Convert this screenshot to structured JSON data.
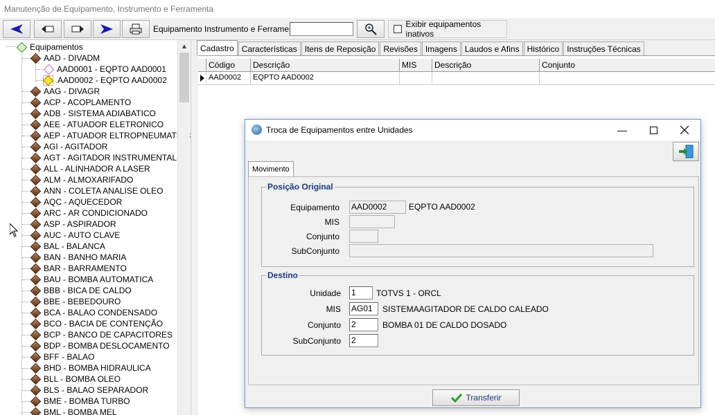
{
  "window": {
    "title": "Manutenção de Equipamento, Instrumento e Ferramenta"
  },
  "toolbar": {
    "search_label": "Equipamento Instrumento e Ferramenta",
    "search_value": "",
    "show_inactive_label": "Exibir equipamentos inativos"
  },
  "tree": {
    "root": "Equipamentos",
    "expanded": "AAD - DIVADM",
    "children": [
      "AAD0001 - EQPTO AAD0001",
      "AAD0002 - EQPTO AAD0002"
    ],
    "items": [
      "AAG - DIVAGR",
      "ACP - ACOPLAMENTO",
      "ADB - SISTEMA ADIABATICO",
      "AEE - ATUADOR ELETRONICO",
      "AEP - ATUADOR ELTROPNEUMATICC",
      "AGI - AGITADOR",
      "AGT - AGITADOR INSTRUMENTAL",
      "ALL - ALINHADOR A LASER",
      "ALM - ALMOXARIFADO",
      "ANN - COLETA ANALISE OLEO",
      "AQC - AQUECEDOR",
      "ARC - AR CONDICIONADO",
      "ASP - ASPIRADOR",
      "AUC - AUTO CLAVE",
      "BAL - BALANCA",
      "BAN - BANHO MARIA",
      "BAR - BARRAMENTO",
      "BAU - BOMBA AUTOMATICA",
      "BBB - BICA DE CALDO",
      "BBE - BEBEDOURO",
      "BCA - BALAO CONDENSADO",
      "BCO - BACIA DE CONTENÇÃO",
      "BCP - BANCO DE CAPACITORES",
      "BDP - BOMBA DESLOCAMENTO",
      "BFF - BALAO",
      "BHD - BOMBA HIDRAULICA",
      "BLL - BOMBA OLEO",
      "BLS - BALAO SEPARADOR",
      "BME - BOMBA TURBO",
      "BML - BOMBA MEL"
    ]
  },
  "tabs": [
    "Cadastro",
    "Características",
    "Itens de Reposição",
    "Revisões",
    "Imagens",
    "Laudos e Afins",
    "Histórico",
    "Instruções Técnicas"
  ],
  "grid": {
    "columns": [
      "Código",
      "Descrição",
      "MIS",
      "Descrição",
      "Conjunto"
    ],
    "rows": [
      [
        "AAD0002",
        "EQPTO AAD0002",
        "",
        "",
        ""
      ]
    ]
  },
  "dialog": {
    "title": "Troca de Equipamentos entre Unidades",
    "tab": "Movimento",
    "original": {
      "title": "Posição Original",
      "equipamento_label": "Equipamento",
      "equipamento_code": "AAD0002",
      "equipamento_desc": "EQPTO AAD0002",
      "mis_label": "MIS",
      "mis_value": "",
      "conjunto_label": "Conjunto",
      "conjunto_value": "",
      "subconjunto_label": "SubConjunto",
      "subconjunto_value": ""
    },
    "destino": {
      "title": "Destino",
      "unidade_label": "Unidade",
      "unidade_value": "1",
      "unidade_desc": "TOTVS 1 - ORCL",
      "mis_label": "MIS",
      "mis_value": "AG01",
      "mis_desc": "SISTEMAAGITADOR DE CALDO CALEADO",
      "conjunto_label": "Conjunto",
      "conjunto_value": "2",
      "conjunto_desc": "BOMBA 01 DE CALDO DOSADO",
      "subconjunto_label": "SubConjunto",
      "subconjunto_value": "2"
    },
    "transfer_label": "Transferir"
  }
}
